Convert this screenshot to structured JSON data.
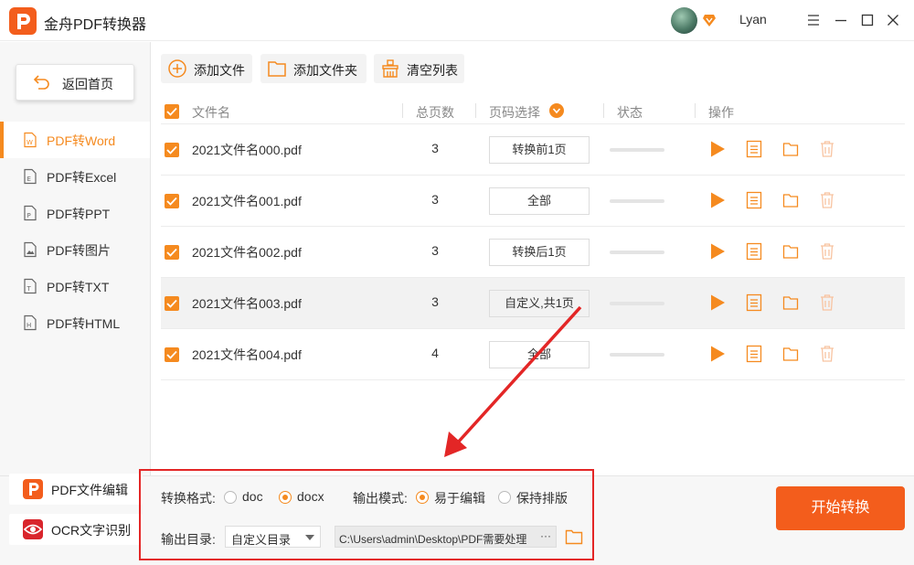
{
  "app": {
    "title": "金舟PDF转换器",
    "user_name": "Lyan"
  },
  "sidebar": {
    "back_label": "返回首页",
    "items": [
      {
        "label": "PDF转Word",
        "icon": "word-doc-icon",
        "active": true
      },
      {
        "label": "PDF转Excel",
        "icon": "excel-doc-icon",
        "active": false
      },
      {
        "label": "PDF转PPT",
        "icon": "ppt-doc-icon",
        "active": false
      },
      {
        "label": "PDF转图片",
        "icon": "image-doc-icon",
        "active": false
      },
      {
        "label": "PDF转TXT",
        "icon": "txt-doc-icon",
        "active": false
      },
      {
        "label": "PDF转HTML",
        "icon": "html-doc-icon",
        "active": false
      }
    ]
  },
  "toolbar": {
    "add_file": "添加文件",
    "add_folder": "添加文件夹",
    "clear_list": "清空列表"
  },
  "table": {
    "headers": {
      "name": "文件名",
      "pages": "总页数",
      "page_select": "页码选择",
      "status": "状态",
      "actions": "操作"
    },
    "rows": [
      {
        "name": "2021文件名000.pdf",
        "pages": "3",
        "page_select": "转换前1页",
        "progress": 0
      },
      {
        "name": "2021文件名001.pdf",
        "pages": "3",
        "page_select": "全部",
        "progress": 0
      },
      {
        "name": "2021文件名002.pdf",
        "pages": "3",
        "page_select": "转换后1页",
        "progress": 0
      },
      {
        "name": "2021文件名003.pdf",
        "pages": "3",
        "page_select": "自定义,共1页",
        "progress": 0
      },
      {
        "name": "2021文件名004.pdf",
        "pages": "4",
        "page_select": "全部",
        "progress": 0
      }
    ]
  },
  "bottom": {
    "edit_tool": "PDF文件编辑",
    "ocr_tool": "OCR文字识别",
    "format_label": "转换格式:",
    "format_options": [
      "doc",
      "docx"
    ],
    "format_selected": "docx",
    "mode_label": "输出模式:",
    "mode_options": [
      "易于编辑",
      "保持排版"
    ],
    "mode_selected": "易于编辑",
    "dir_label": "输出目录:",
    "dir_select": "自定义目录",
    "dir_path": "C:\\Users\\admin\\Desktop\\PDF需要处理",
    "dir_more": "···",
    "start_button": "开始转换"
  },
  "colors": {
    "accent": "#f58a1f",
    "brand": "#f35d1c",
    "highlight_border": "#e32626"
  }
}
